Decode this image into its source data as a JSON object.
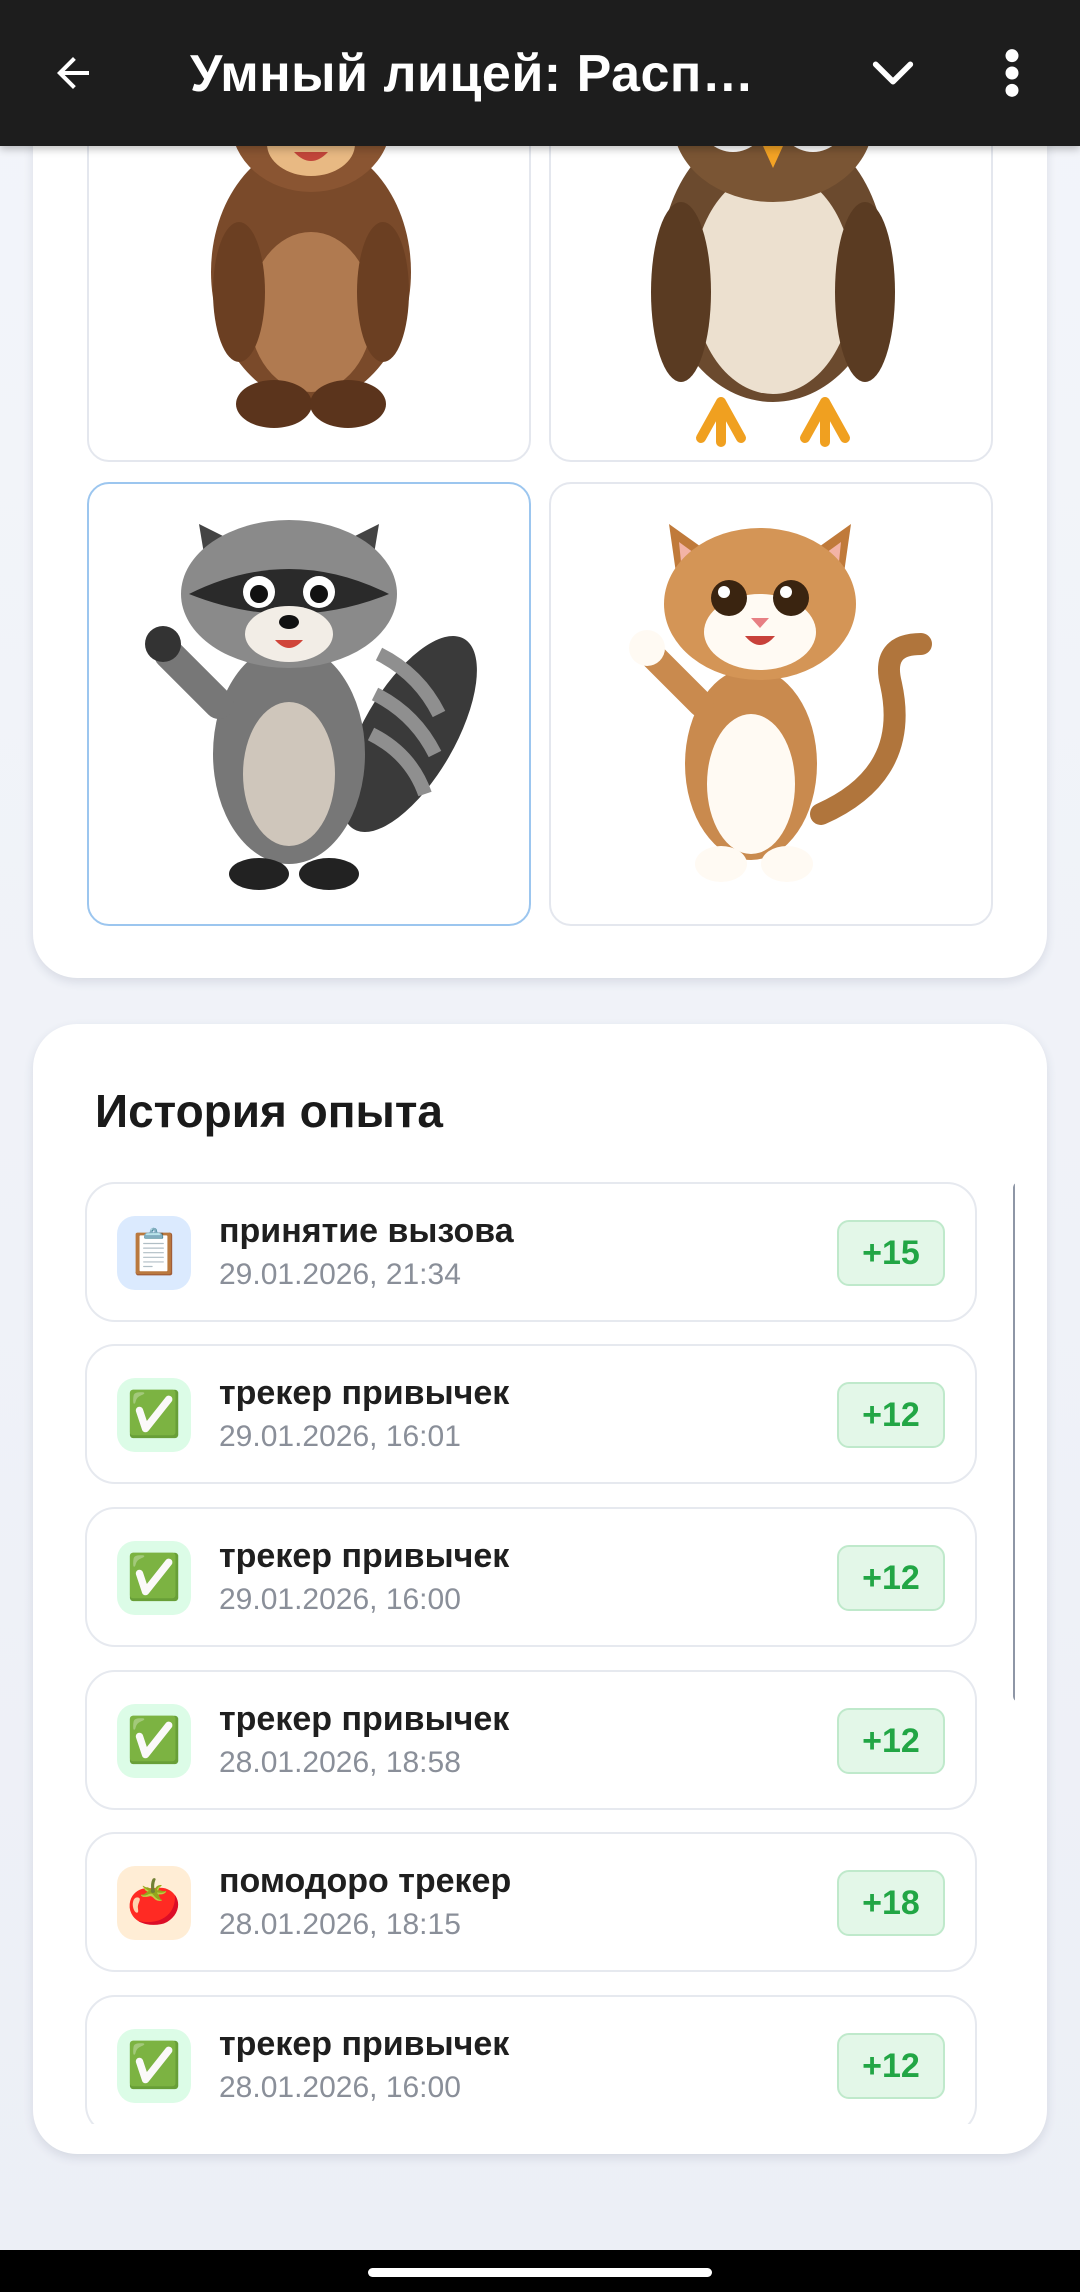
{
  "appbar": {
    "title": "Умный лицей: Распис…",
    "icons": [
      "arrow-back-icon",
      "chevron-down-icon",
      "more-vert-icon"
    ]
  },
  "avatars": {
    "items": [
      {
        "animal": "bear",
        "selected": false
      },
      {
        "animal": "owl",
        "selected": false
      },
      {
        "animal": "raccoon",
        "selected": true
      },
      {
        "animal": "cat",
        "selected": false
      }
    ]
  },
  "history": {
    "title": "История опыта",
    "items": [
      {
        "icon": "📋",
        "icon_name": "clipboard-icon",
        "tone": "blue",
        "name": "принятие вызова",
        "date": "29.01.2026, 21:34",
        "xp": "+15"
      },
      {
        "icon": "✅",
        "icon_name": "check-mark-icon",
        "tone": "green",
        "name": "трекер привычек",
        "date": "29.01.2026, 16:01",
        "xp": "+12"
      },
      {
        "icon": "✅",
        "icon_name": "check-mark-icon",
        "tone": "green",
        "name": "трекер привычек",
        "date": "29.01.2026, 16:00",
        "xp": "+12"
      },
      {
        "icon": "✅",
        "icon_name": "check-mark-icon",
        "tone": "green",
        "name": "трекер привычек",
        "date": "28.01.2026, 18:58",
        "xp": "+12"
      },
      {
        "icon": "🍅",
        "icon_name": "tomato-icon",
        "tone": "orange",
        "name": "помодоро трекер",
        "date": "28.01.2026, 18:15",
        "xp": "+18"
      },
      {
        "icon": "✅",
        "icon_name": "check-mark-icon",
        "tone": "green",
        "name": "трекер привычек",
        "date": "28.01.2026, 16:00",
        "xp": "+12"
      }
    ]
  },
  "colors": {
    "appbar": "#1d1d1d",
    "selected_border": "#9cc6ef",
    "xp_text": "#22a645",
    "xp_bg": "#e3f7e8"
  }
}
